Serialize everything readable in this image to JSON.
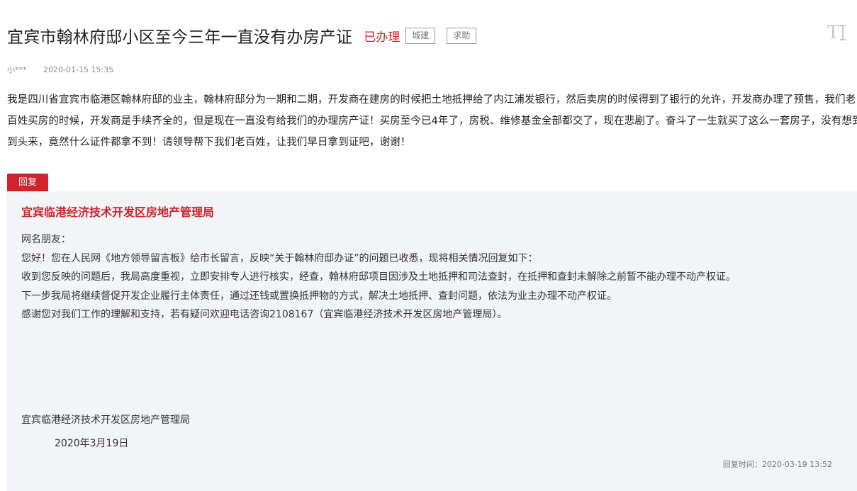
{
  "post": {
    "title": "宜宾市翰林府邸小区至今三年一直没有办房产证",
    "status": "已办理",
    "tags": [
      "城建",
      "求助"
    ],
    "author": "小***",
    "date": "2020-01-15 15:35",
    "content": "我是四川省宜宾市临港区翰林府邸的业主，翰林府邸分为一期和二期，开发商在建房的时候把土地抵押给了内江浦发银行，然后卖房的时候得到了银行的允许，开发商办理了预售，我们老百姓买房的时候，开发商是手续齐全的，但是现在一直没有给我们的办理房产证！买房至今已4年了，房税、维修基金全部都交了，现在悲剧了。奋斗了一生就买了这么一套房子，没有想到到头来，竟然什么证件都拿不到！请领导帮下我们老百姓，让我们早日拿到证吧，谢谢！"
  },
  "reply": {
    "tag": "回复",
    "org": "宜宾临港经济技术开发区房地产管理局",
    "lines": [
      "网名朋友：",
      "您好！您在人民网《地方领导留言板》给市长留言，反映“关于翰林府邸办证”的问题已收悉，现将相关情况回复如下：",
      "收到您反映的问题后，我局高度重视，立即安排专人进行核实，经查，翰林府邸项目因涉及土地抵押和司法查封，在抵押和查封未解除之前暂不能办理不动产权证。",
      "下一步我局将继续督促开发企业履行主体责任，通过还钱或置换抵押物的方式，解决土地抵押、查封问题，依法为业主办理不动产权证。",
      "感谢您对我们工作的理解和支持，若有疑问欢迎电话咨询2108167（宜宾临港经济技术开发区房地产管理局）。"
    ],
    "signature_org": "宜宾临港经济技术开发区房地产管理局",
    "signature_date": "2020年3月19日",
    "reply_time": "回复时间：2020-03-19 13:52"
  },
  "icons": {
    "font_size": "font-size-icon"
  },
  "colors": {
    "accent_red": "#d0232c",
    "reply_background": "#f2f4f8",
    "meta_gray": "#8a8a8a"
  }
}
